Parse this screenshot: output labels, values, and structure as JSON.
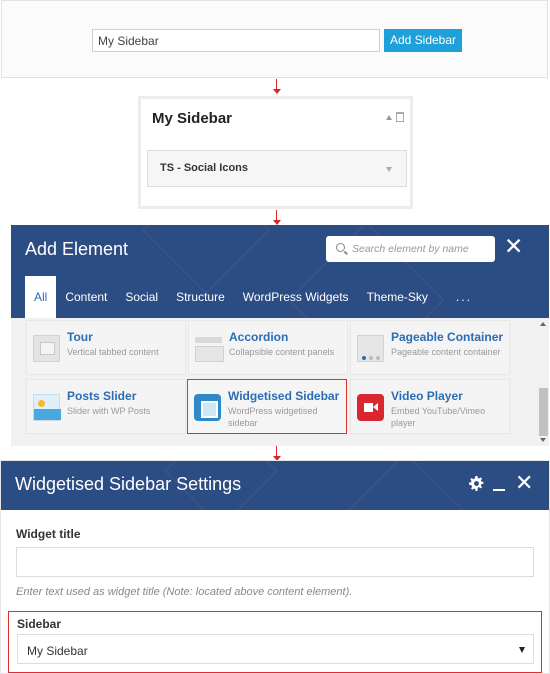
{
  "create_sidebar": {
    "input_value": "My Sidebar",
    "button_label": "Add Sidebar"
  },
  "sidebar_widget_area": {
    "title": "My Sidebar",
    "widget_label": "TS - Social Icons"
  },
  "add_element": {
    "title": "Add Element",
    "search_placeholder": "Search element by name",
    "close_glyph": "✕",
    "tabs": [
      {
        "label": "All",
        "active": true
      },
      {
        "label": "Content"
      },
      {
        "label": "Social"
      },
      {
        "label": "Structure"
      },
      {
        "label": "WordPress Widgets"
      },
      {
        "label": "Theme-Sky"
      },
      {
        "label": "..."
      }
    ],
    "elements": [
      {
        "name": "Tour",
        "desc": "Vertical tabbed content",
        "icon": "tour-icon"
      },
      {
        "name": "Accordion",
        "desc": "Collapsible content panels",
        "icon": "accordion-icon"
      },
      {
        "name": "Pageable Container",
        "desc": "Pageable content container",
        "icon": "pageable-container-icon"
      },
      {
        "name": "Posts Slider",
        "desc": "Slider with WP Posts",
        "icon": "posts-slider-icon"
      },
      {
        "name": "Widgetised Sidebar",
        "desc": "WordPress widgetised sidebar",
        "icon": "widgetised-sidebar-icon",
        "highlighted": true
      },
      {
        "name": "Video Player",
        "desc": "Embed YouTube/Vimeo player",
        "icon": "video-player-icon"
      }
    ]
  },
  "settings": {
    "title": "Widgetised Sidebar Settings",
    "close_glyph": "✕",
    "widget_title_label": "Widget title",
    "widget_title_value": "",
    "widget_title_help": "Enter text used as widget title (Note: located above content element).",
    "sidebar_label": "Sidebar",
    "sidebar_selected": "My Sidebar"
  },
  "colors": {
    "header_bg": "#2c4c84",
    "accent_blue": "#1ea0d8",
    "link_blue": "#2b6db3",
    "highlight_red": "#e0312f"
  }
}
